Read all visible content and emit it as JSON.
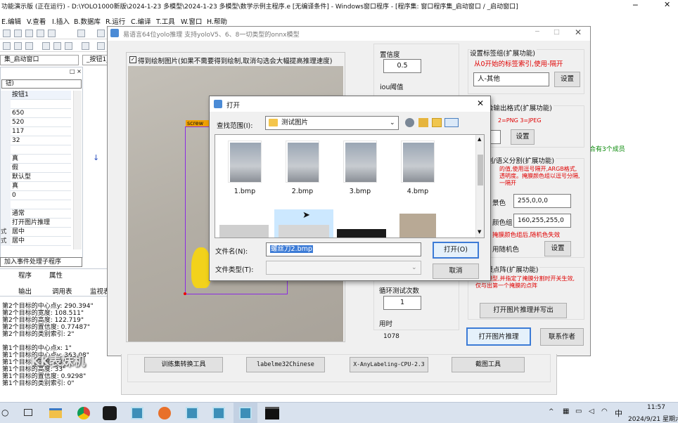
{
  "ide": {
    "title": "功能演示版 (正在运行) - D:\\YOLO1000新版\\2024-1-23 多模型\\2024-1-23 多模型\\数学示例主程序.e [无编译条件] - Windows窗口程序 - [程序集: 窗口程序集_启动窗口 / _启动窗口]",
    "menu": [
      "E.编辑",
      "V.查看",
      "I.插入",
      "B.数据库",
      "R.运行",
      "C.编译",
      "T.工具",
      "W.窗口",
      "H.帮助"
    ],
    "combo_left": "集_启动窗口",
    "combo_right": "_按钮1_",
    "prop_panel_title": "□ ×",
    "prop_combo": "钮)",
    "props": [
      {
        "key": "",
        "val": "按钮1"
      },
      {
        "key": "",
        "val": ""
      },
      {
        "key": "",
        "val": "650"
      },
      {
        "key": "",
        "val": "520"
      },
      {
        "key": "",
        "val": "117"
      },
      {
        "key": "",
        "val": "32"
      },
      {
        "key": "",
        "val": ""
      },
      {
        "key": "",
        "val": "真"
      },
      {
        "key": "",
        "val": "假"
      },
      {
        "key": "",
        "val": "默认型"
      },
      {
        "key": "",
        "val": "真"
      },
      {
        "key": "",
        "val": "0"
      },
      {
        "key": "",
        "val": ""
      },
      {
        "key": "",
        "val": "通常"
      },
      {
        "key": "",
        "val": "打开图片推理"
      },
      {
        "key": "式",
        "val": "居中"
      },
      {
        "key": "式",
        "val": "居中"
      }
    ],
    "event_combo": "加入事件处理子程序",
    "left_tabs": [
      "程序",
      "属性"
    ],
    "output_tabs": [
      "输出",
      "调用表",
      "监视表"
    ],
    "output_lines": [
      "第2个目标的中心点y: 290.394\"",
      "第2个目标的宽度: 108.511\"",
      "第2个目标的高度: 122.719\"",
      "第2个目标的置信度: 0.77487\"",
      "第2个目标的类别索引: 2\"",
      "",
      "第1个目标的中心点x: 1\"",
      "第1个目标的中心点y: 363.08\"",
      "第1个目标的宽度: 50\"",
      "第1个目标的高度: 33\"",
      "第1个目标的置信度: 0.9298\"",
      "第1个目标的类别索引: 0\""
    ],
    "watermark": "KK表妹机",
    "side_note": "合有3个成员"
  },
  "app": {
    "title": "易语言64位yolo推理    支持yoloV5、6、8一切类型的onnx模型",
    "checkbox_label": "得到绘制图片(如果不需要得到绘制,取消勾选会大幅提高推理速度)",
    "checkbox_checked": true,
    "detect_label": "screw",
    "conf_label": "置信度",
    "conf_value": "0.5",
    "iou_label": "iou阈值",
    "tag_group_title": "设置标签组(扩展功能)",
    "tag_hint": "从0开始的标签索引,使用-隔开",
    "tag_value": "人-其他",
    "set_button": "设置",
    "format_title": "像输出格式(扩展功能)",
    "format_hint": "2=PNG  3=JPEG",
    "format_set_button": "设置",
    "seg_title": "割/语义分割(扩展功能)",
    "seg_hint": "的值,使用逗号隔开,ARGB格式,透明度。掩膜颜色组以逗号分隔,一隔开",
    "bg_label": "景色",
    "bg_value": "255,0,0,0",
    "color_label": "颜色组",
    "color_value": "160,255,255,0",
    "random_hint": "掩膜颜色组后,随机色失效",
    "random_label": "用随机色",
    "random_set_button": "设置",
    "keypoint_title": "掩膜点阵(扩展功能)",
    "keypoint_hint": "分割模型,并指定了掩膜分割时开关生效,仅与出第一个掩膜的点阵",
    "export_button": "打开图片推理并写出",
    "loop_label": "循环测试次数",
    "loop_value": "1",
    "time_label": "用时",
    "time_value": "1078",
    "infer_button": "打开图片推理",
    "contact_button": "联系作者",
    "bottom_buttons": [
      "训练集转换工具",
      "labelme32Chinese",
      "X-AnyLabeling-CPU-2.3",
      "截图工具"
    ]
  },
  "dialog": {
    "title": "打开",
    "lookin_label": "查找范围(I):",
    "lookin_value": "测试图片",
    "files": [
      "1.bmp",
      "2.bmp",
      "3.bmp",
      "4.bmp"
    ],
    "filename_label": "文件名(N):",
    "filename_value": "螺丝刀2.bmp",
    "filetype_label": "文件类型(T):",
    "filetype_value": "",
    "open_button": "打开(O)",
    "cancel_button": "取消"
  },
  "taskbar": {
    "time": "11:57",
    "date": "2024/9/21 星期六",
    "ime": "中",
    "icons": [
      "start-icon",
      "task-view-icon",
      "file-explorer-icon",
      "chrome-icon",
      "qq-icon",
      "e-lang-icon",
      "e-lang-icon",
      "app-icon",
      "e-lang-icon",
      "e-lang-icon",
      "e-lang-icon",
      "terminal-icon"
    ]
  }
}
